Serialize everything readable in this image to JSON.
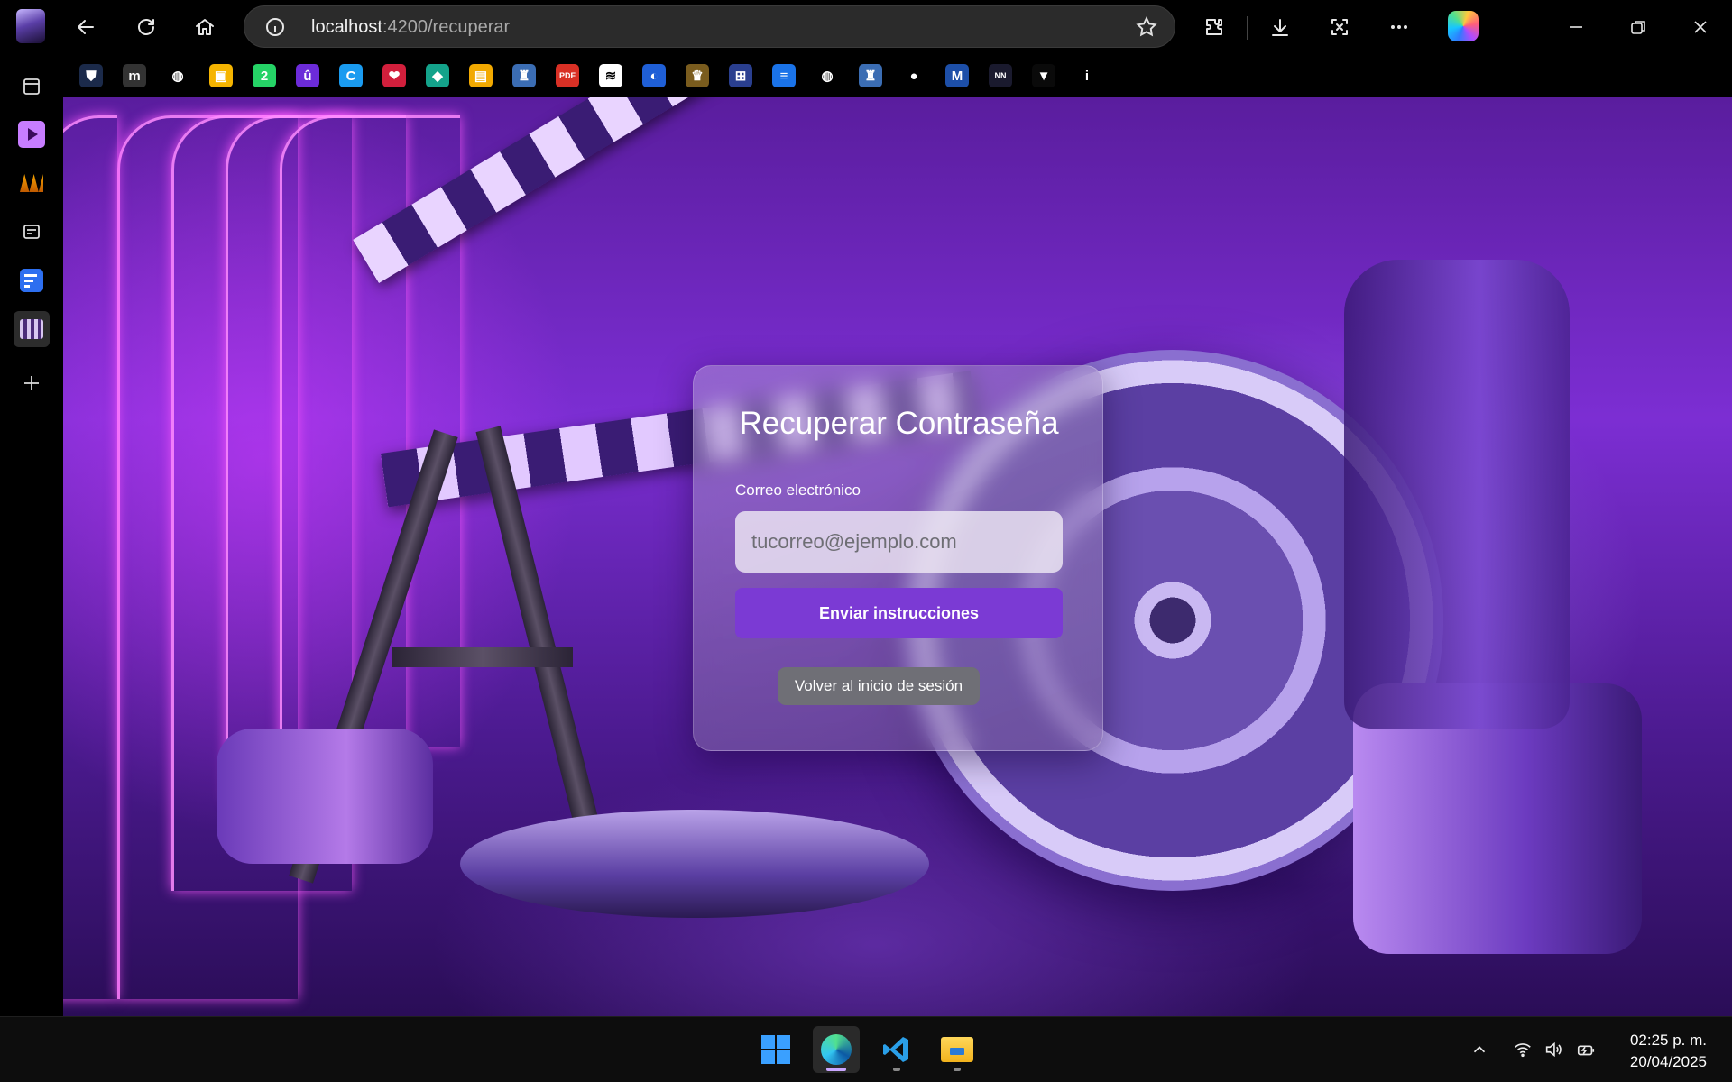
{
  "browser": {
    "url_host": "localhost",
    "url_path": ":4200/recuperar",
    "favorites": [
      {
        "icon": "bitwarden-icon",
        "glyph": "⛊",
        "color": "#1b2a4a"
      },
      {
        "icon": "m-logo-icon",
        "glyph": "m",
        "color": "#333333"
      },
      {
        "icon": "globe-icon",
        "glyph": "◍",
        "color": "#000000"
      },
      {
        "icon": "google-classroom-icon",
        "glyph": "▣",
        "color": "#f5b400"
      },
      {
        "icon": "whatsapp-icon",
        "glyph": "2",
        "color": "#25d366"
      },
      {
        "icon": "u-badge-icon",
        "glyph": "û",
        "color": "#6c2bd9"
      },
      {
        "icon": "canva-icon",
        "glyph": "C",
        "color": "#1a9bf0"
      },
      {
        "icon": "heart-icon",
        "glyph": "❤",
        "color": "#d21f3c"
      },
      {
        "icon": "diamond-icon",
        "glyph": "◆",
        "color": "#14a38b"
      },
      {
        "icon": "book-icon",
        "glyph": "▤",
        "color": "#f2a900"
      },
      {
        "icon": "python-icon",
        "glyph": "♜",
        "color": "#3b6db3"
      },
      {
        "icon": "pdf-icon",
        "glyph": "PDF",
        "color": "#d93025"
      },
      {
        "icon": "mee-icon",
        "glyph": "≋",
        "color": "#ffffff"
      },
      {
        "icon": "edge-blue-icon",
        "glyph": "◐",
        "color": "#1f5fd6"
      },
      {
        "icon": "shield-crest-icon",
        "glyph": "♛",
        "color": "#7a5c1e"
      },
      {
        "icon": "grid-apps-icon",
        "glyph": "⊞",
        "color": "#2a3f8f"
      },
      {
        "icon": "docs-icon",
        "glyph": "≡",
        "color": "#1a73e8"
      },
      {
        "icon": "globe-icon-2",
        "glyph": "◍",
        "color": "#000000"
      },
      {
        "icon": "python-icon-2",
        "glyph": "♜",
        "color": "#3b6db3"
      },
      {
        "icon": "github-icon",
        "glyph": "●",
        "color": "#000000"
      },
      {
        "icon": "mi-icon",
        "glyph": "M",
        "color": "#1d4fa8"
      },
      {
        "icon": "nn-icon",
        "glyph": "NN",
        "color": "#1a1a2e"
      },
      {
        "icon": "vuetify-icon",
        "glyph": "▼",
        "color": "#0a0a0a"
      },
      {
        "icon": "info-i-icon",
        "glyph": "i",
        "color": "#000000"
      }
    ]
  },
  "page": {
    "title": "Recuperar Contraseña",
    "email_label": "Correo electrónico",
    "email_placeholder": "tucorreo@ejemplo.com",
    "email_value": "",
    "submit_label": "Enviar instrucciones",
    "back_label": "Volver al inicio de sesión"
  },
  "taskbar": {
    "time": "02:25 p. m.",
    "date": "20/04/2025"
  },
  "colors": {
    "accent": "#7b3ad4",
    "secondary_button": "#6f6f76",
    "background_purple": "#7c2ed3"
  }
}
